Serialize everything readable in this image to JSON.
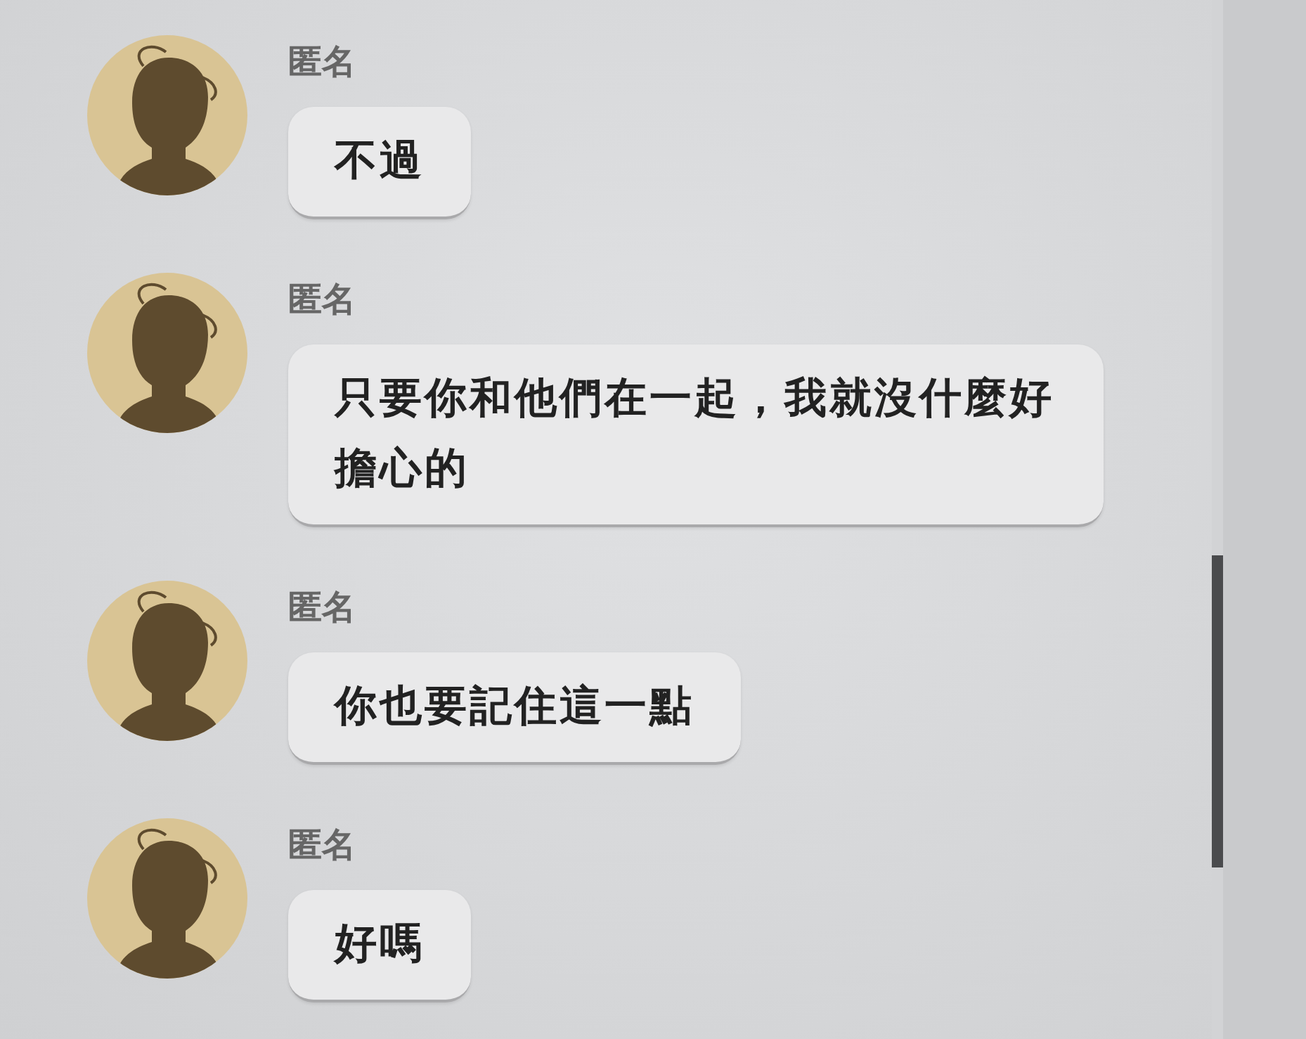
{
  "messages": [
    {
      "sender": "匿名",
      "text": "不過"
    },
    {
      "sender": "匿名",
      "text": "只要你和他們在一起，我就沒什麼好擔心的"
    },
    {
      "sender": "匿名",
      "text": "你也要記住這一點"
    },
    {
      "sender": "匿名",
      "text": "好嗎"
    }
  ]
}
